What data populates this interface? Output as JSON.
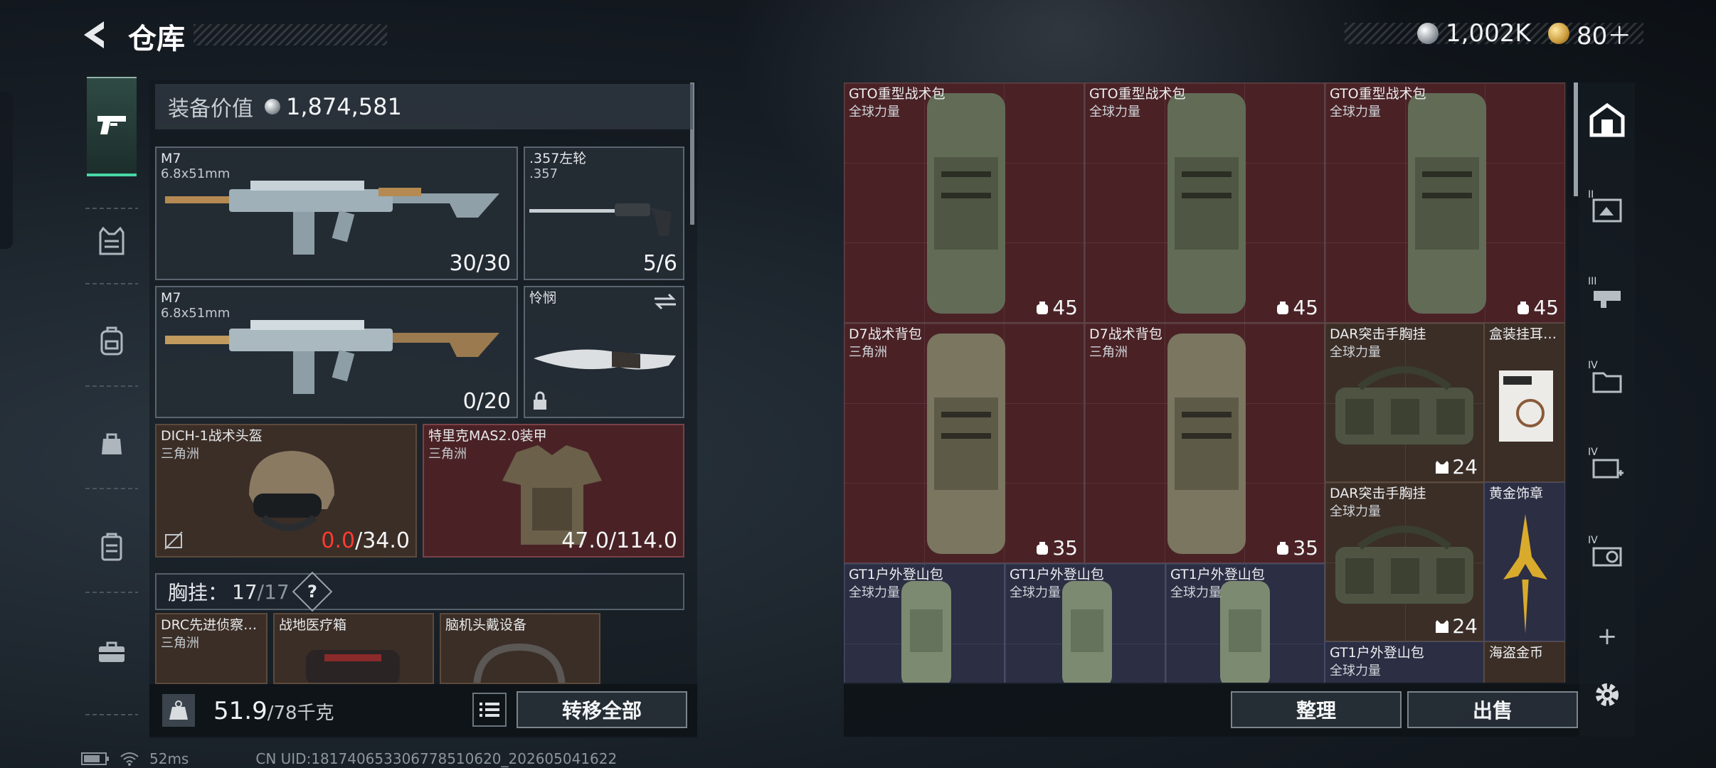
{
  "header": {
    "title": "仓库",
    "currencies": [
      {
        "icon": "silver-coin-icon",
        "value": "1,002K"
      },
      {
        "icon": "gold-coin-icon",
        "value": "80＋"
      }
    ]
  },
  "left_rail": {
    "items": [
      {
        "icon": "pistol-icon",
        "active": true
      },
      {
        "icon": "chest-rig-icon",
        "active": false
      },
      {
        "icon": "backpack-icon",
        "active": false
      },
      {
        "icon": "bag-icon",
        "active": false
      },
      {
        "icon": "case-icon",
        "active": false
      },
      {
        "icon": "toolbox-icon",
        "active": false
      }
    ]
  },
  "loadout": {
    "value_label": "装备价值",
    "value": "1,874,581",
    "slots": [
      {
        "name": "M7",
        "sub": "6.8x51mm",
        "count": "30/30"
      },
      {
        "name": ".357左轮",
        "sub": ".357",
        "count": "5/6"
      },
      {
        "name": "M7",
        "sub": "6.8x51mm",
        "count": "0/20"
      },
      {
        "name": "怜悯",
        "sub": "",
        "count": ""
      },
      {
        "name": "DICH-1战术头盔",
        "sub": "三角洲",
        "count_red": "0.0",
        "count_rest": "/34.0"
      },
      {
        "name": "特里克MAS2.0装甲",
        "sub": "三角洲",
        "count": "47.0/114.0"
      }
    ],
    "chest": {
      "label": "胸挂：",
      "current": "17",
      "max": "/17",
      "help": "?"
    },
    "pockets": [
      {
        "name": "DRC先进侦察…",
        "sub": "三角洲"
      },
      {
        "name": "战地医疗箱",
        "sub": ""
      },
      {
        "name": "脑机头戴设备",
        "sub": ""
      }
    ],
    "weight": {
      "current": "51.9",
      "max": "/78千克"
    },
    "transfer_all": "转移全部"
  },
  "stash": {
    "items": [
      {
        "name": "GTO重型战术包",
        "sub": "全球力量",
        "capacity": "45"
      },
      {
        "name": "GTO重型战术包",
        "sub": "全球力量",
        "capacity": "45"
      },
      {
        "name": "GTO重型战术包",
        "sub": "全球力量",
        "capacity": "45"
      },
      {
        "name": "D7战术背包",
        "sub": "三角洲",
        "capacity": "35"
      },
      {
        "name": "D7战术背包",
        "sub": "三角洲",
        "capacity": "35"
      },
      {
        "name": "DAR突击手胸挂",
        "sub": "全球力量",
        "capacity": "24"
      },
      {
        "name": "盒装挂耳…",
        "sub": ""
      },
      {
        "name": "DAR突击手胸挂",
        "sub": "全球力量",
        "capacity": "24"
      },
      {
        "name": "黄金饰章",
        "sub": ""
      },
      {
        "name": "GT1户外登山包",
        "sub": "全球力量"
      },
      {
        "name": "GT1户外登山包",
        "sub": "全球力量"
      },
      {
        "name": "GT1户外登山包",
        "sub": "全球力量"
      },
      {
        "name": "GT1户外登山包",
        "sub": "全球力量"
      },
      {
        "name": "海盗金币",
        "sub": ""
      }
    ],
    "sort_label": "整理",
    "sell_label": "出售"
  },
  "right_tabs": [
    {
      "icon": "home-icon",
      "tier": ""
    },
    {
      "icon": "stash-page-icon",
      "tier": "II"
    },
    {
      "icon": "stash-page-icon",
      "tier": "III"
    },
    {
      "icon": "stash-page-icon",
      "tier": "IV"
    },
    {
      "icon": "stash-page-icon",
      "tier": "IV"
    },
    {
      "icon": "stash-page-icon",
      "tier": "IV"
    }
  ],
  "right_tools": {
    "add": "+",
    "settings_icon": "settings-icon"
  },
  "status_bar": {
    "ping": "52ms",
    "uid": "CN UID:181740653306778510620_202605041622"
  },
  "colors": {
    "accent": "#49d7a5",
    "slot_red": "#4a2226",
    "slot_brown": "#3b2e27",
    "slot_blue": "#2c2e44",
    "warning": "#ff3b30"
  }
}
